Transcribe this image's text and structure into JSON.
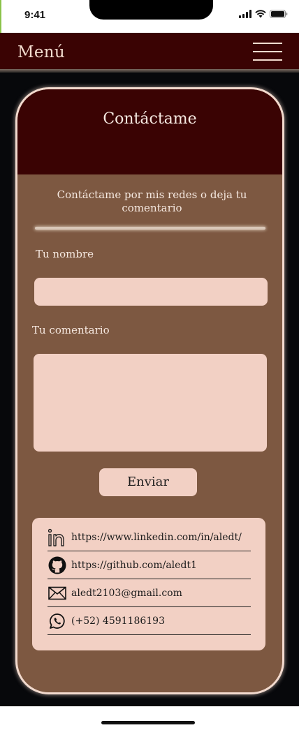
{
  "status_bar": {
    "time": "9:41"
  },
  "nav": {
    "menu_label": "Menú"
  },
  "contact": {
    "title": "Contáctame",
    "subtitle": "Contáctame por mis redes o deja tu comentario",
    "name_label": "Tu nombre",
    "name_value": "",
    "comment_label": "Tu comentario",
    "comment_value": "",
    "submit_label": "Enviar"
  },
  "social": {
    "linkedin": "https://www.linkedin.com/in/aledt/",
    "github": "https://github.com/aledt1",
    "email": "aledt2103@gmail.com",
    "whatsapp": "(+52) 4591186193"
  },
  "colors": {
    "nav_bg": "#3a0303",
    "card_bg": "#7d5841",
    "input_bg": "#f2d0c4",
    "page_bg": "#07080b",
    "text_light": "#f6e9e1"
  },
  "icons": [
    "cellular-signal-icon",
    "wifi-icon",
    "battery-icon",
    "hamburger-menu-icon",
    "linkedin-icon",
    "github-icon",
    "mail-icon",
    "whatsapp-icon"
  ]
}
